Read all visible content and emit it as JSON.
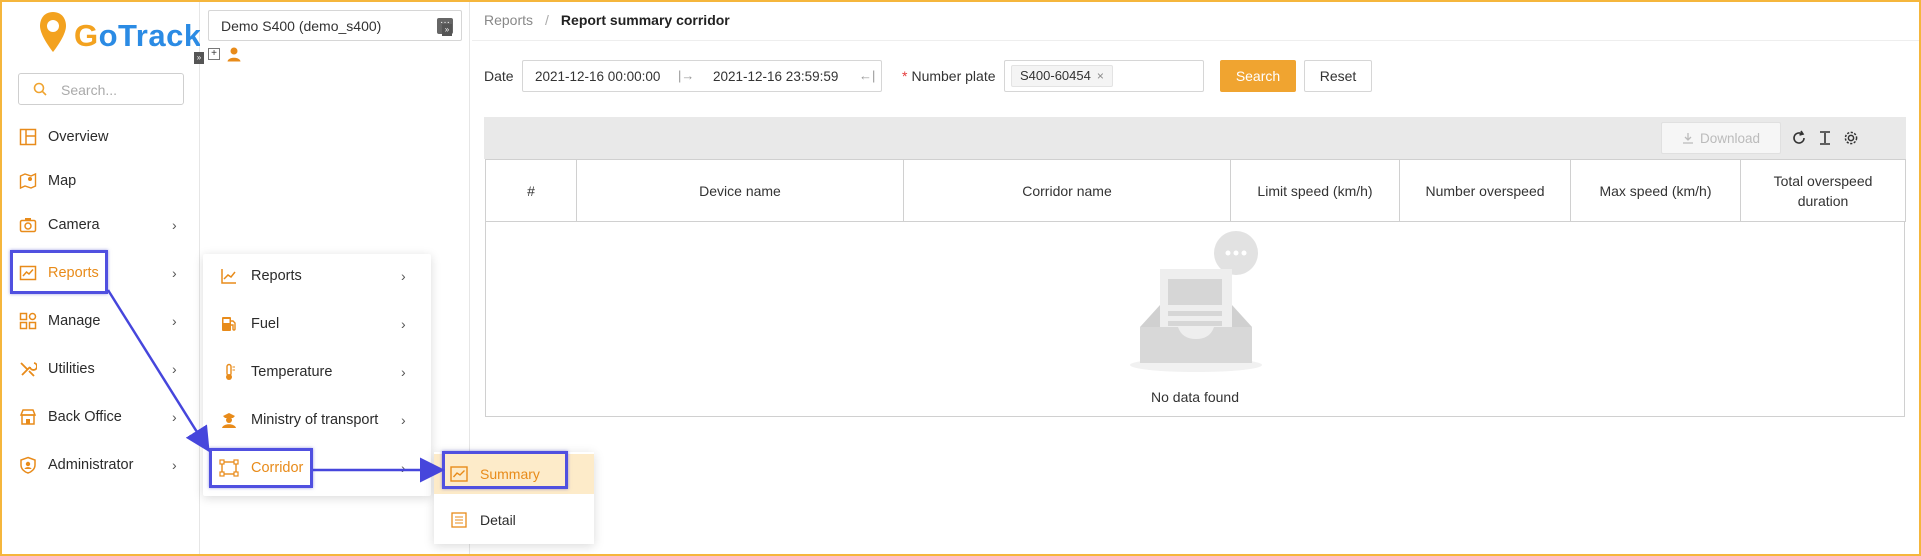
{
  "app": {
    "logo_prefix": "G",
    "logo_rest": "oTrack"
  },
  "nav": {
    "search_placeholder": "Search...",
    "items": [
      {
        "label": "Overview",
        "icon": "overview-icon",
        "has_children": false
      },
      {
        "label": "Map",
        "icon": "map-icon",
        "has_children": false
      },
      {
        "label": "Camera",
        "icon": "camera-icon",
        "has_children": true
      },
      {
        "label": "Reports",
        "icon": "reports-icon",
        "has_children": true,
        "active": true
      },
      {
        "label": "Manage",
        "icon": "manage-icon",
        "has_children": true
      },
      {
        "label": "Utilities",
        "icon": "utilities-icon",
        "has_children": true
      },
      {
        "label": "Back Office",
        "icon": "back-office-icon",
        "has_children": true
      },
      {
        "label": "Administrator",
        "icon": "administrator-icon",
        "has_children": true
      }
    ]
  },
  "device_panel": {
    "selected_device": "Demo S400 (demo_s400)"
  },
  "flyout": {
    "items": [
      {
        "label": "Reports",
        "icon": "chart-line-icon"
      },
      {
        "label": "Fuel",
        "icon": "fuel-pump-icon"
      },
      {
        "label": "Temperature",
        "icon": "thermometer-icon"
      },
      {
        "label": "Ministry of transport",
        "icon": "officer-icon"
      },
      {
        "label": "Corridor",
        "icon": "corridor-icon",
        "active": true
      }
    ]
  },
  "submenu": {
    "items": [
      {
        "label": "Summary",
        "icon": "summary-icon",
        "selected": true
      },
      {
        "label": "Detail",
        "icon": "detail-list-icon"
      }
    ]
  },
  "breadcrumb": {
    "parent": "Reports",
    "separator": "/",
    "current": "Report summary corridor"
  },
  "filters": {
    "date_label": "Date",
    "date_from": "2021-12-16 00:00:00",
    "date_to": "2021-12-16 23:59:59",
    "plate_required_mark": "*",
    "plate_label": "Number plate",
    "plate_value": "S400-60454",
    "search_label": "Search",
    "reset_label": "Reset"
  },
  "toolbar": {
    "download_label": "Download"
  },
  "table": {
    "columns": [
      "#",
      "Device name",
      "Corridor name",
      "Limit speed (km/h)",
      "Number overspeed",
      "Max speed (km/h)",
      "Total overspeed duration"
    ],
    "rows": [],
    "empty_message": "No data found"
  },
  "colors": {
    "accent": "#f0a430",
    "brand_blue": "#2b8be4",
    "highlight": "#5050e0"
  }
}
